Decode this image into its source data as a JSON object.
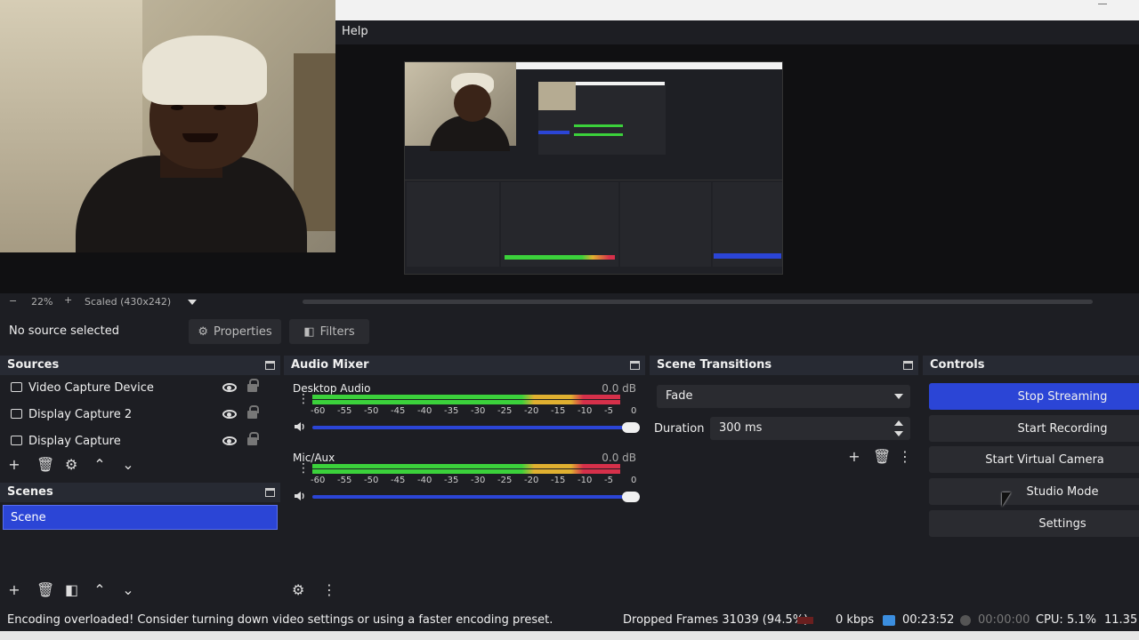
{
  "menu": {
    "help": "Help"
  },
  "scale": {
    "minus": "−",
    "zoom": "22%",
    "plus": "+",
    "scaled": "Scaled (430x242)"
  },
  "source_bar": {
    "no_source": "No source selected",
    "properties": "Properties",
    "filters": "Filters"
  },
  "sources": {
    "title": "Sources",
    "items": [
      {
        "label": "Video Capture Device",
        "icon": "camera-icon"
      },
      {
        "label": "Display Capture 2",
        "icon": "monitor-icon"
      },
      {
        "label": "Display Capture",
        "icon": "monitor-icon"
      }
    ]
  },
  "scenes": {
    "title": "Scenes",
    "items": [
      "Scene"
    ]
  },
  "mixer": {
    "title": "Audio Mixer",
    "channels": [
      {
        "name": "Desktop Audio",
        "db": "0.0 dB",
        "level": 0.95
      },
      {
        "name": "Mic/Aux",
        "db": "0.0 dB",
        "level": 0.95
      }
    ],
    "ticks": [
      "-60",
      "-55",
      "-50",
      "-45",
      "-40",
      "-35",
      "-30",
      "-25",
      "-20",
      "-15",
      "-10",
      "-5",
      "0"
    ]
  },
  "transitions": {
    "title": "Scene Transitions",
    "selected": "Fade",
    "duration_label": "Duration",
    "duration_value": "300 ms"
  },
  "controls": {
    "title": "Controls",
    "stop_streaming": "Stop Streaming",
    "start_recording": "Start Recording",
    "start_virtual_camera": "Start Virtual Camera",
    "studio_mode": "Studio Mode",
    "settings": "Settings"
  },
  "status": {
    "message": "Encoding overloaded! Consider turning down video settings or using a faster encoding preset.",
    "dropped": "Dropped Frames 31039 (94.5%)",
    "kbps": "0 kbps",
    "stream_time": "00:23:52",
    "rec_time": "00:00:00",
    "cpu": "CPU: 5.1%",
    "fps": "11.35 /"
  },
  "colors": {
    "accent": "#2b45d6",
    "background": "#1d1e23",
    "dock_title": "#272a33",
    "meter_green": "#3bd13b",
    "meter_yellow": "#e0b030",
    "meter_red": "#d6304a"
  }
}
